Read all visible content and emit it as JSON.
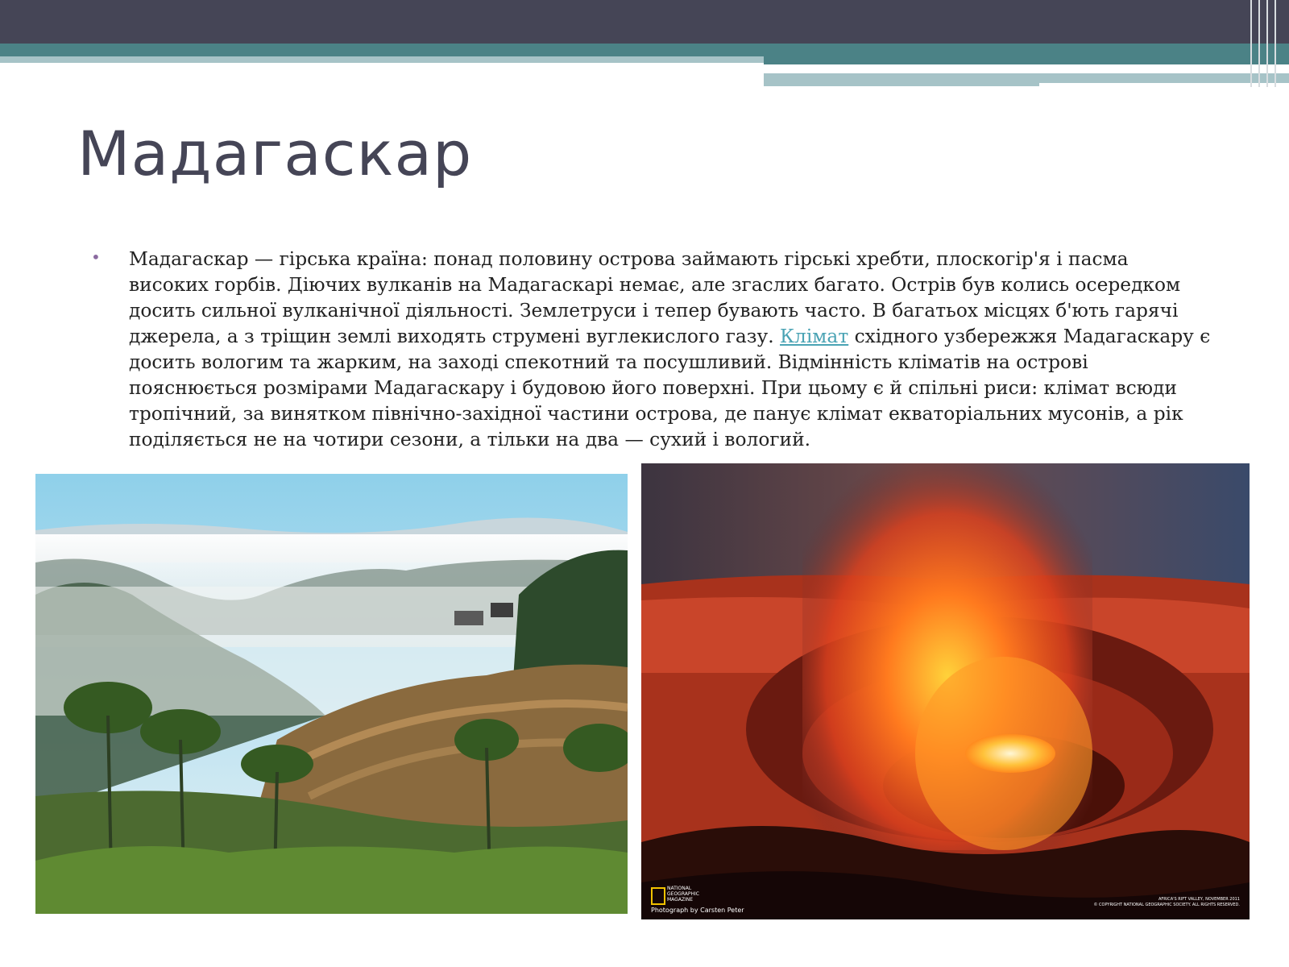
{
  "title": "Мадагаскар",
  "paragraph": {
    "before_link": "Мадагаскар — гірська країна: понад половину острова займають гірські хребти, плоскогір'я і пасма високих горбів. Діючих вулканів на Мадагаскарі немає, але згаслих багато. Острів був колись осередком досить сильної вулканічної діяльності. Землетруси і тепер бувають часто. В багатьох місцях б'ють гарячі джерела, а з тріщин землі виходять струмені вуглекислого газу. ",
    "link": "Клімат",
    "after_link": " східного узбережжя Мадагаскару є досить вологим та жарким, на заході спекотний та посушливий. Відмінність кліматів на острові пояснюється розмірами Мадагаскару і будовою його поверхні. При цьому є й спільні риси: клімат всюди тропічний, за винятком північно-західної частини острова, де панує клімат екваторіальних мусонів, а рік поділяється не на чотири сезони, а тільки на два — сухий і вологий."
  },
  "bullet": "•",
  "photo_right": {
    "natgeo": "NATIONAL GEOGRAPHIC MAGAZINE",
    "credit": "Photograph by Carsten Peter",
    "caption_line1": "AFRICA'S RIFT VALLEY, NOVEMBER 2011",
    "caption_line2": "© COPYRIGHT NATIONAL GEOGRAPHIC SOCIETY. ALL RIGHTS RESERVED."
  },
  "colors": {
    "header_dark": "#454556",
    "header_teal": "#4b8286",
    "header_light": "#a6c3c7",
    "title": "#454556",
    "link": "#4aa3b4",
    "bullet": "#8b6aa0"
  }
}
